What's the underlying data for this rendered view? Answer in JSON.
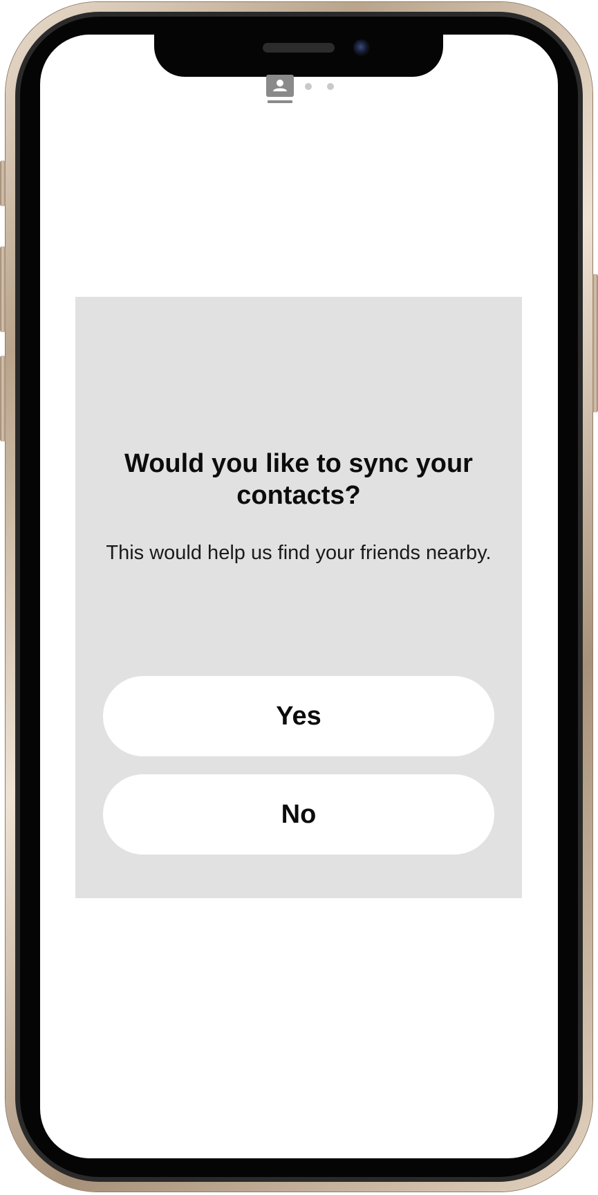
{
  "header": {
    "icon": "contact-card-icon",
    "total_pages": 3,
    "current_page": 1
  },
  "dialog": {
    "title": "Would you like to sync your contacts?",
    "subtitle": "This would help us find your friends nearby.",
    "yes_label": "Yes",
    "no_label": "No"
  },
  "colors": {
    "card_background": "#e1e1e1",
    "button_background": "#ffffff",
    "text": "#0c0c0c",
    "indicator_icon": "#8a8a8a",
    "indicator_dot": "#c9c9c9"
  }
}
